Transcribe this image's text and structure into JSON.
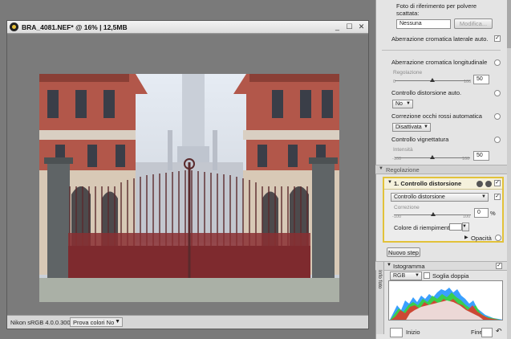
{
  "window": {
    "title": "BRA_4081.NEF* @ 16% | 12,5MB",
    "buttons": {
      "minimize": "_",
      "maximize": "☐",
      "close": "✕"
    }
  },
  "statusbar": {
    "profile": "Nikon sRGB 4.0.0.3002",
    "proof_colors": "Prova colori No"
  },
  "panel": {
    "reference_photo": {
      "label": "Foto di riferimento per polvere scattata:",
      "value": "Nessuna",
      "modify_button": "Modifica..."
    },
    "lateral_aberration": {
      "label": "Aberrazione cromatica laterale auto.",
      "checked": true
    },
    "longitudinal_aberration": {
      "label": "Aberrazione cromatica longitudinale",
      "sub": "Regolazione",
      "min": "0",
      "max": "100",
      "value": "50"
    },
    "distortion_auto": {
      "label": "Controllo distorsione auto.",
      "value": "No"
    },
    "red_eye": {
      "label": "Correzione occhi rossi automatica",
      "value": "Disattivata"
    },
    "vignette": {
      "label": "Controllo vignettatura",
      "sub": "Intensità",
      "min": "-100",
      "max": "100",
      "value": "50"
    },
    "regolazione": {
      "label": "Regolazione"
    },
    "step": {
      "title": "1. Controllo distorsione",
      "combo": "Controllo distorsione",
      "sub": "Correzione",
      "min": "-100",
      "max": "100",
      "value": "0",
      "unit": "%",
      "fill_label": "Colore di riempimento",
      "opacity_label": "Opacità"
    },
    "new_step_button": "Nuovo step",
    "histogram": {
      "tab_label": "Info foto",
      "title": "Istogramma",
      "channel": "RGB",
      "double_threshold": "Soglia doppia",
      "start_label": "Inizio",
      "end_label": "Fine",
      "start_value": "",
      "end_value": ""
    }
  },
  "colors": {
    "step_border": "#e2c23a",
    "gate_red": "#7e2a2e",
    "facade_brick": "#b2574a"
  }
}
